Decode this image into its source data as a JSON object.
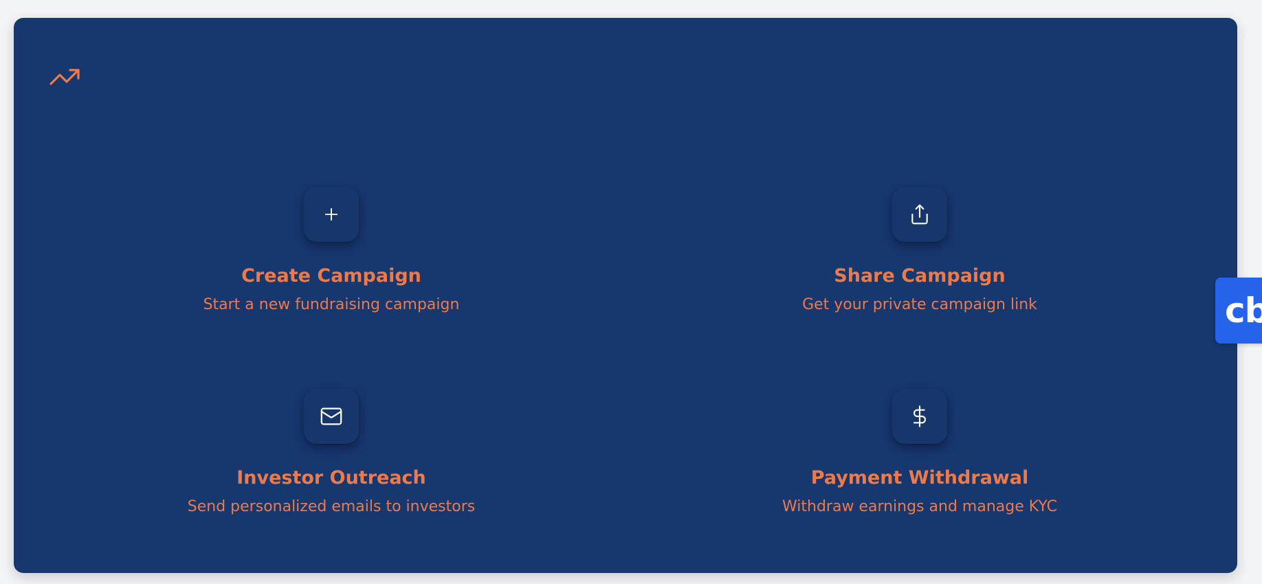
{
  "colors": {
    "page_background": "#f3f4f6",
    "panel_background": "#17376f",
    "accent": "#ee7a4a",
    "icon_tile": "#17366c",
    "icon_stroke": "#ffffff",
    "badge_background": "#2563eb"
  },
  "header": {
    "icon": "trending-up-icon"
  },
  "actions": [
    {
      "icon": "plus-icon",
      "title": "Create Campaign",
      "subtitle": "Start a new fundraising campaign"
    },
    {
      "icon": "share-icon",
      "title": "Share Campaign",
      "subtitle": "Get your private campaign link"
    },
    {
      "icon": "mail-icon",
      "title": "Investor Outreach",
      "subtitle": "Send personalized emails to investors"
    },
    {
      "icon": "dollar-icon",
      "title": "Payment Withdrawal",
      "subtitle": "Withdraw earnings and manage KYC"
    }
  ],
  "badge": {
    "label": "cb"
  }
}
